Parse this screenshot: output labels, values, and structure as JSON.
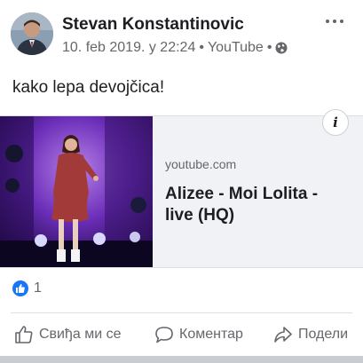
{
  "post": {
    "author": "Stevan Konstantinovic",
    "date": "10. feb 2019. у 22:24",
    "separator": "•",
    "source": "YouTube",
    "separator2": "•",
    "privacy_icon": "globe-icon",
    "text": "kako lepa devojčica!"
  },
  "link": {
    "domain": "youtube.com",
    "title": "Alizee - Moi Lolita - live (HQ)",
    "info_icon_glyph": "i"
  },
  "reactions": {
    "icon": "like-icon",
    "count": "1"
  },
  "actions": {
    "like_label": "Свиђа ми се",
    "comment_label": "Коментар",
    "share_label": "Подели"
  },
  "colors": {
    "accent": "#1877f2",
    "secondary_text": "#65676b",
    "card_background": "#f0f2f5"
  }
}
